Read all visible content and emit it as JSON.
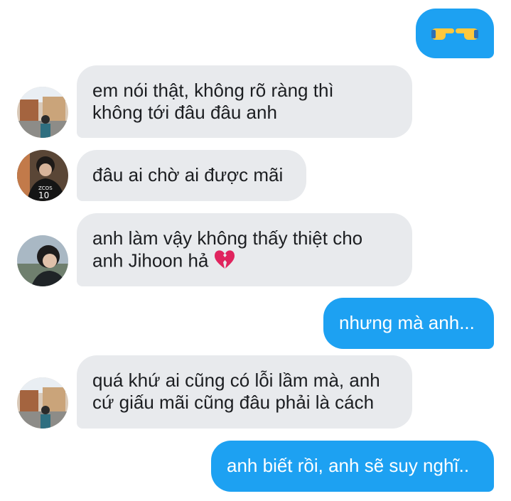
{
  "conversation": {
    "messages": [
      {
        "direction": "outgoing",
        "lines": [
          ""
        ],
        "emoji": "pointing-hands"
      },
      {
        "direction": "incoming",
        "lines": [
          "em nói thật, không rõ ràng thì",
          "không tới đâu đâu anh"
        ]
      },
      {
        "direction": "incoming",
        "lines": [
          "đâu ai chờ ai được mãi"
        ]
      },
      {
        "direction": "incoming",
        "lines": [
          "anh làm vậy không thấy thiệt cho",
          "anh Jihoon hả"
        ],
        "emoji": "broken-heart"
      },
      {
        "direction": "outgoing",
        "lines": [
          "nhưng mà anh..."
        ]
      },
      {
        "direction": "incoming",
        "lines": [
          "quá khứ ai cũng có lỗi lầm mà, anh",
          "cứ giấu mãi cũng đâu phải là cách"
        ]
      },
      {
        "direction": "outgoing",
        "lines": [
          "anh biết rồi, anh sẽ suy nghĩ.."
        ]
      }
    ]
  },
  "colors": {
    "outgoing_bubble": "#1da1f2",
    "incoming_bubble": "#e8eaed",
    "incoming_text": "#1c1e21",
    "outgoing_text": "#ffffff",
    "broken_heart": "#e0245e",
    "hand_emoji": "#ffc83d"
  }
}
